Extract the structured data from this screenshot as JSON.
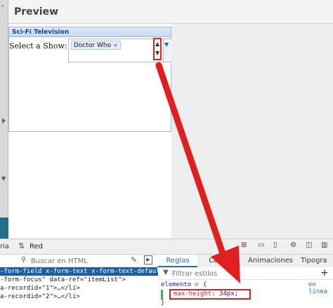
{
  "preview": {
    "title": "Preview",
    "panel_title": "Sci-Fi Television",
    "field_label": "Select a Show:",
    "tag_value": "Doctor Who",
    "tag_close": "×",
    "scroll_up": "▲",
    "scroll_down": "▼",
    "trigger": "▼"
  },
  "devtools": {
    "left_tab_partial": "ria",
    "network_tab": "Red",
    "search_placeholder": "Buscar en HTML",
    "tree_lines": [
      "-form-field x-form-text x-form-text-default\"",
      "-form-focus\" data-ref=\"itemList\">",
      "a-recordid=\"1\">…</li>",
      "a-recordid=\"2\">…</li>"
    ],
    "rules_tabs": {
      "rules": "Reglas",
      "computed": "Calc",
      "animations": "Animaciones",
      "typography": "Tipogra"
    },
    "filter_placeholder": "Filtrar estilos",
    "add_rule": "+",
    "selector": "elemento",
    "brace_open": "{",
    "brace_close": "}",
    "inline_link": "en línea",
    "declaration": {
      "property": "max-height",
      "value": "34px"
    }
  },
  "colors": {
    "annotation": "#e02020",
    "selection": "#1c5fa8",
    "accent": "#1c6ed8"
  }
}
